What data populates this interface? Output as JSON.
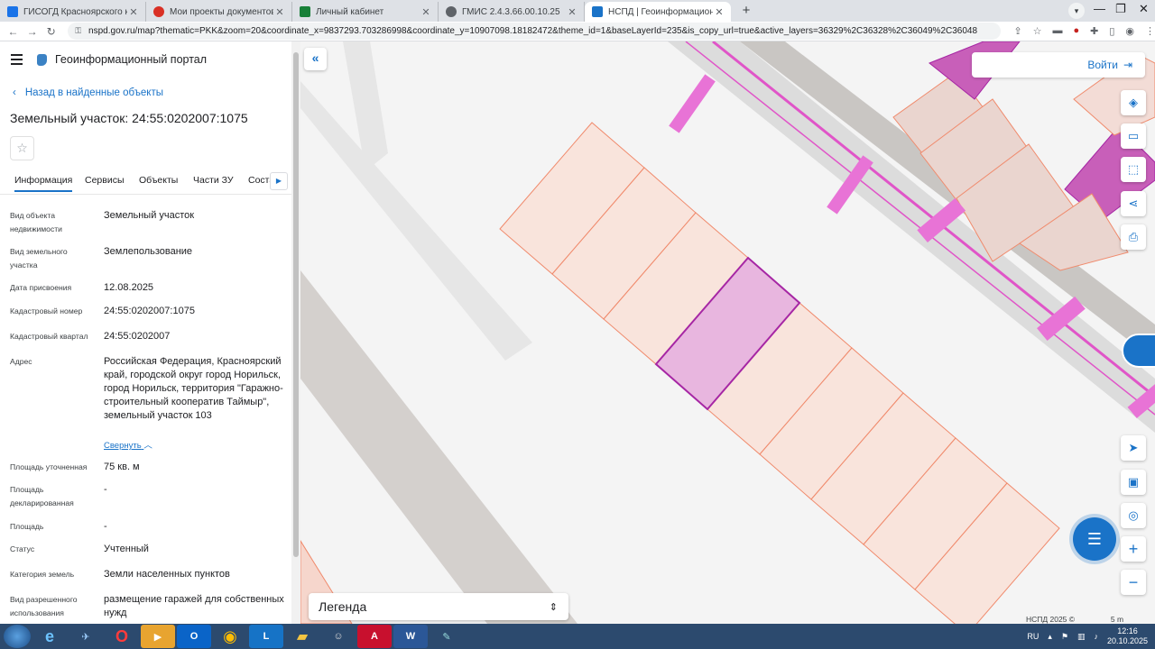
{
  "browser": {
    "tabs": [
      {
        "title": "ГИСОГД Красноярского края",
        "color": "#1a73e8"
      },
      {
        "title": "Мои проекты документов",
        "color": "#d93025"
      },
      {
        "title": "Личный кабинет",
        "color": "#188038"
      },
      {
        "title": "ГМИС 2.4.3.66.00.10.25",
        "color": "#5f6368"
      },
      {
        "title": "НСПД | Геоинформационный п",
        "color": "#1a73c8"
      }
    ],
    "new_tab": "+",
    "url": "nspd.gov.ru/map?thematic=PKK&zoom=20&coordinate_x=9837293.703286998&coordinate_y=10907098.18182472&theme_id=1&baseLayerId=235&is_copy_url=true&active_layers=36329%2C36328%2C36049%2C36048"
  },
  "app": {
    "title": "Геоинформационный портал"
  },
  "panel": {
    "back_label": "Назад в найденные объекты",
    "title": "Земельный участок: 24:55:0202007:1075",
    "tabs": [
      "Информация",
      "Сервисы",
      "Объекты",
      "Части ЗУ",
      "Соста"
    ],
    "collapse_link": "Свернуть",
    "fields": [
      {
        "label": "Вид объекта недвижимости",
        "value": "Земельный участок"
      },
      {
        "label": "Вид земельного участка",
        "value": "Землепользование"
      },
      {
        "label": "Дата присвоения",
        "value": "12.08.2025"
      },
      {
        "label": "Кадастровый номер",
        "value": "24:55:0202007:1075"
      },
      {
        "label": "Кадастровый квартал",
        "value": "24:55:0202007"
      },
      {
        "label": "Адрес",
        "value": "Российская Федерация, Красноярский край, городской округ город Норильск, город Норильск, территория \"Гаражно-строительный кооператив Таймыр\", земельный участок 103"
      },
      {
        "label": "Площадь уточненная",
        "value": "75 кв. м"
      },
      {
        "label": "Площадь декларированная",
        "value": "-"
      },
      {
        "label": "Площадь",
        "value": "-"
      },
      {
        "label": "Статус",
        "value": "Учтенный"
      },
      {
        "label": "Категория земель",
        "value": "Земли населенных пунктов"
      },
      {
        "label": "Вид разрешенного использования",
        "value": "размещение гаражей для собственных нужд"
      }
    ]
  },
  "map": {
    "login_label": "Войти",
    "legend_label": "Легенда",
    "copyright": "НСПД 2025 ©",
    "scale_label": "5 m",
    "colors": {
      "parcel_fill": "#f9e4dc",
      "parcel_stroke": "#f08a6c",
      "selected_fill": "#e8b6df",
      "selected_stroke": "#a626a4",
      "road": "#d6d3d1",
      "zone_line": "#e055c8"
    }
  },
  "taskbar": {
    "lang": "RU",
    "time": "12:16",
    "date": "20.10.2025"
  }
}
